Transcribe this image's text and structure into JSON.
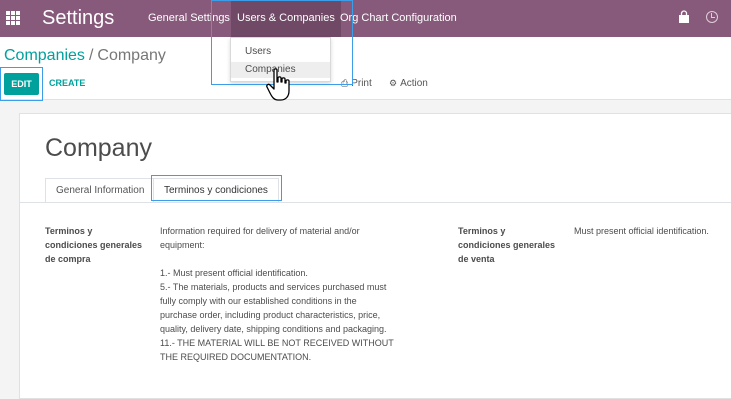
{
  "navbar": {
    "app_title": "Settings",
    "menu": [
      {
        "label": "General Settings"
      },
      {
        "label": "Users & Companies"
      },
      {
        "label": "Org Chart Configuration"
      }
    ]
  },
  "dropdown": {
    "items": [
      {
        "label": "Users"
      },
      {
        "label": "Companies"
      }
    ]
  },
  "breadcrumb": {
    "parent": "Companies",
    "separator": "/",
    "current": "Company"
  },
  "toolbar": {
    "edit_label": "EDIT",
    "create_label": "CREATE",
    "print_label": "Print",
    "action_label": "Action"
  },
  "form": {
    "title": "Company",
    "tabs": [
      {
        "label": "General Information"
      },
      {
        "label": "Terminos y condiciones"
      }
    ],
    "purchase_terms": {
      "label_lines": [
        "Terminos y",
        "condiciones generales",
        "de compra"
      ],
      "value_lines": [
        "Information required for delivery of material and/or",
        "equipment:",
        "",
        "1.- Must present official identification.",
        "5.- The materials, products and services purchased must",
        "fully comply with our established conditions in the",
        "purchase order, including product characteristics, price,",
        "quality, delivery date, shipping conditions and packaging.",
        "11.- THE MATERIAL WILL BE NOT RECEIVED WITHOUT",
        "THE REQUIRED DOCUMENTATION."
      ]
    },
    "sale_terms": {
      "label_lines": [
        "Terminos y",
        "condiciones generales",
        "de venta"
      ],
      "value": "Must present official identification."
    }
  }
}
